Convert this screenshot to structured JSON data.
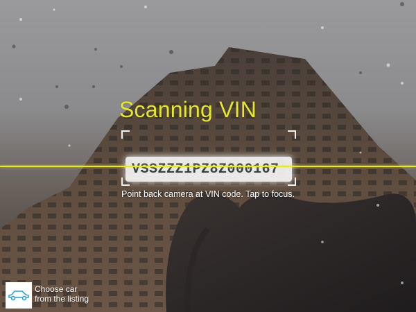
{
  "scanner": {
    "title": "Scanning VIN",
    "detected_vin": "VSSZZZ1PZ8Z000167",
    "hint": "Point back camera at VIN code. Tap to focus."
  },
  "choose_car": {
    "line1": "Choose car",
    "line2": "from the listing",
    "icon": "car-icon"
  },
  "colors": {
    "accent": "#e8e82a",
    "car_icon": "#29a3d6"
  }
}
